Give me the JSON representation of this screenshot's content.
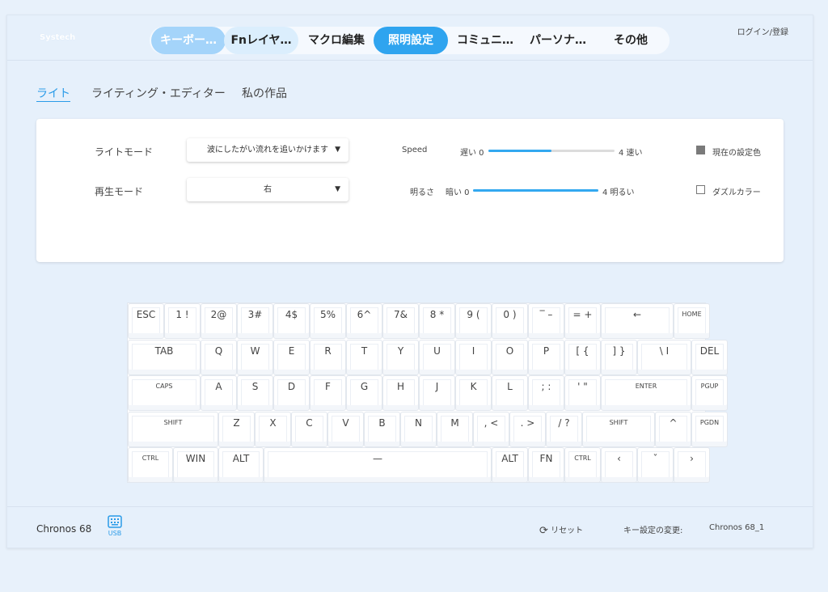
{
  "header": {
    "brand": "Systech",
    "login": "ログイン/登録",
    "tabs": [
      "キーボー…",
      "Fnレイヤ…",
      "マクロ編集",
      "照明設定",
      "コミュニ…",
      "パーソナ…",
      "その他"
    ],
    "active_tab": "照明設定"
  },
  "subtabs": [
    "ライト",
    "ライティング・エディター",
    "私の作品"
  ],
  "active_subtab": "ライト",
  "settings": {
    "light_mode_label": "ライトモード",
    "light_mode_value": "波にしたがい流れを追いかけます",
    "play_mode_label": "再生モード",
    "play_mode_value": "右",
    "speed": {
      "label": "Speed",
      "min_label": "遅い 0",
      "max_label": "4 速い",
      "level": 0.5
    },
    "brightness": {
      "label": "明るさ",
      "min_label": "暗い 0",
      "max_label": "4 明るい",
      "level": 1.0
    },
    "current_color": {
      "label": "現在の設定色",
      "checked": true
    },
    "dazzle_color": {
      "label": "ダズルカラー",
      "checked": false
    }
  },
  "keyboard": {
    "rows": [
      [
        "ESC",
        "1 !",
        "2@",
        "3#",
        "4$",
        "5%",
        "6^",
        "7&",
        "8 *",
        "9 (",
        "0 )",
        "‾ –",
        "= +",
        "←",
        "HOME"
      ],
      [
        "TAB",
        "Q",
        "W",
        "E",
        "R",
        "T",
        "Y",
        "U",
        "I",
        "O",
        "P",
        "[ {",
        "] }",
        "\\ I",
        "DEL"
      ],
      [
        "CAPS",
        "A",
        "S",
        "D",
        "F",
        "G",
        "H",
        "J",
        "K",
        "L",
        "; :",
        "' \"",
        "ENTER",
        "PGUP"
      ],
      [
        "SHIFT",
        "Z",
        "X",
        "C",
        "V",
        "B",
        "N",
        "M",
        ", <",
        ". >",
        "/ ?",
        "SHIFT",
        "^",
        "PGDN"
      ],
      [
        "CTRL",
        "WIN",
        "ALT",
        "—",
        "ALT",
        "FN",
        "CTRL",
        "‹",
        "ˇ",
        "›"
      ]
    ]
  },
  "footer": {
    "device": "Chronos 68",
    "connection": "USB",
    "reset": "リセット",
    "key_config_label": "キー設定の変更:",
    "profile": "Chronos 68_1"
  },
  "colors": {
    "accent": "#2fa4ef",
    "accent_light": "#a4d4fa",
    "background": "#e6f0fb"
  }
}
